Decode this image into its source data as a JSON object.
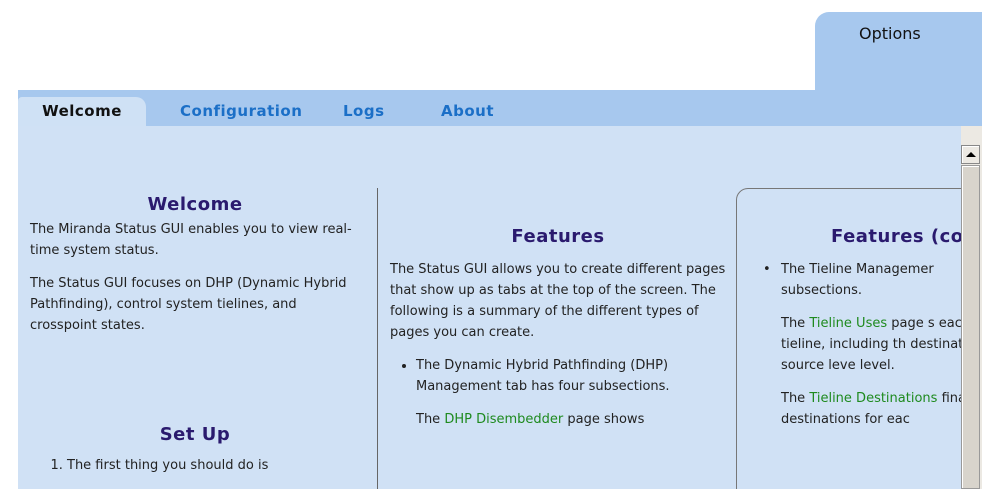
{
  "options_tab": {
    "label": "Options"
  },
  "tabs": [
    {
      "label": "Welcome"
    },
    {
      "label": "Configuration"
    },
    {
      "label": "Logs"
    },
    {
      "label": "About"
    }
  ],
  "welcome": {
    "heading": "Welcome",
    "p1": "The Miranda Status GUI enables you to view real-time system status.",
    "p2": "The Status GUI focuses on DHP (Dynamic Hybrid Pathfinding), control system tielines, and crosspoint states.",
    "setup_heading": "Set Up",
    "setup_item1": "The first thing you should do is"
  },
  "features": {
    "heading": "Features",
    "intro": "The Status GUI allows you to create different pages that show up as tabs at the top of the screen. The following is a summary of the different types of pages you can create.",
    "bullet1": "The Dynamic Hybrid Pathfinding (DHP) Management tab has four subsections.",
    "sub_prefix": "The ",
    "sub_link": "DHP Disembedder",
    "sub_suffix": " page shows"
  },
  "features_cont": {
    "heading": "Features (co",
    "bullet1": "The Tieline Managemer subsections.",
    "p1_prefix": "The ",
    "p1_link": "Tieline Uses",
    "p1_suffix": " page s each tieline, including th destination, source leve level.",
    "p2_prefix": "The ",
    "p2_link": "Tieline Destinations",
    "p2_suffix": " final destinations for eac"
  },
  "colors": {
    "tab_bar": "#a7c8ee",
    "content_bg": "#d0e1f5",
    "link_green": "#1e8a1e",
    "heading": "#2a1a6e",
    "tab_text": "#1b6fc7"
  }
}
